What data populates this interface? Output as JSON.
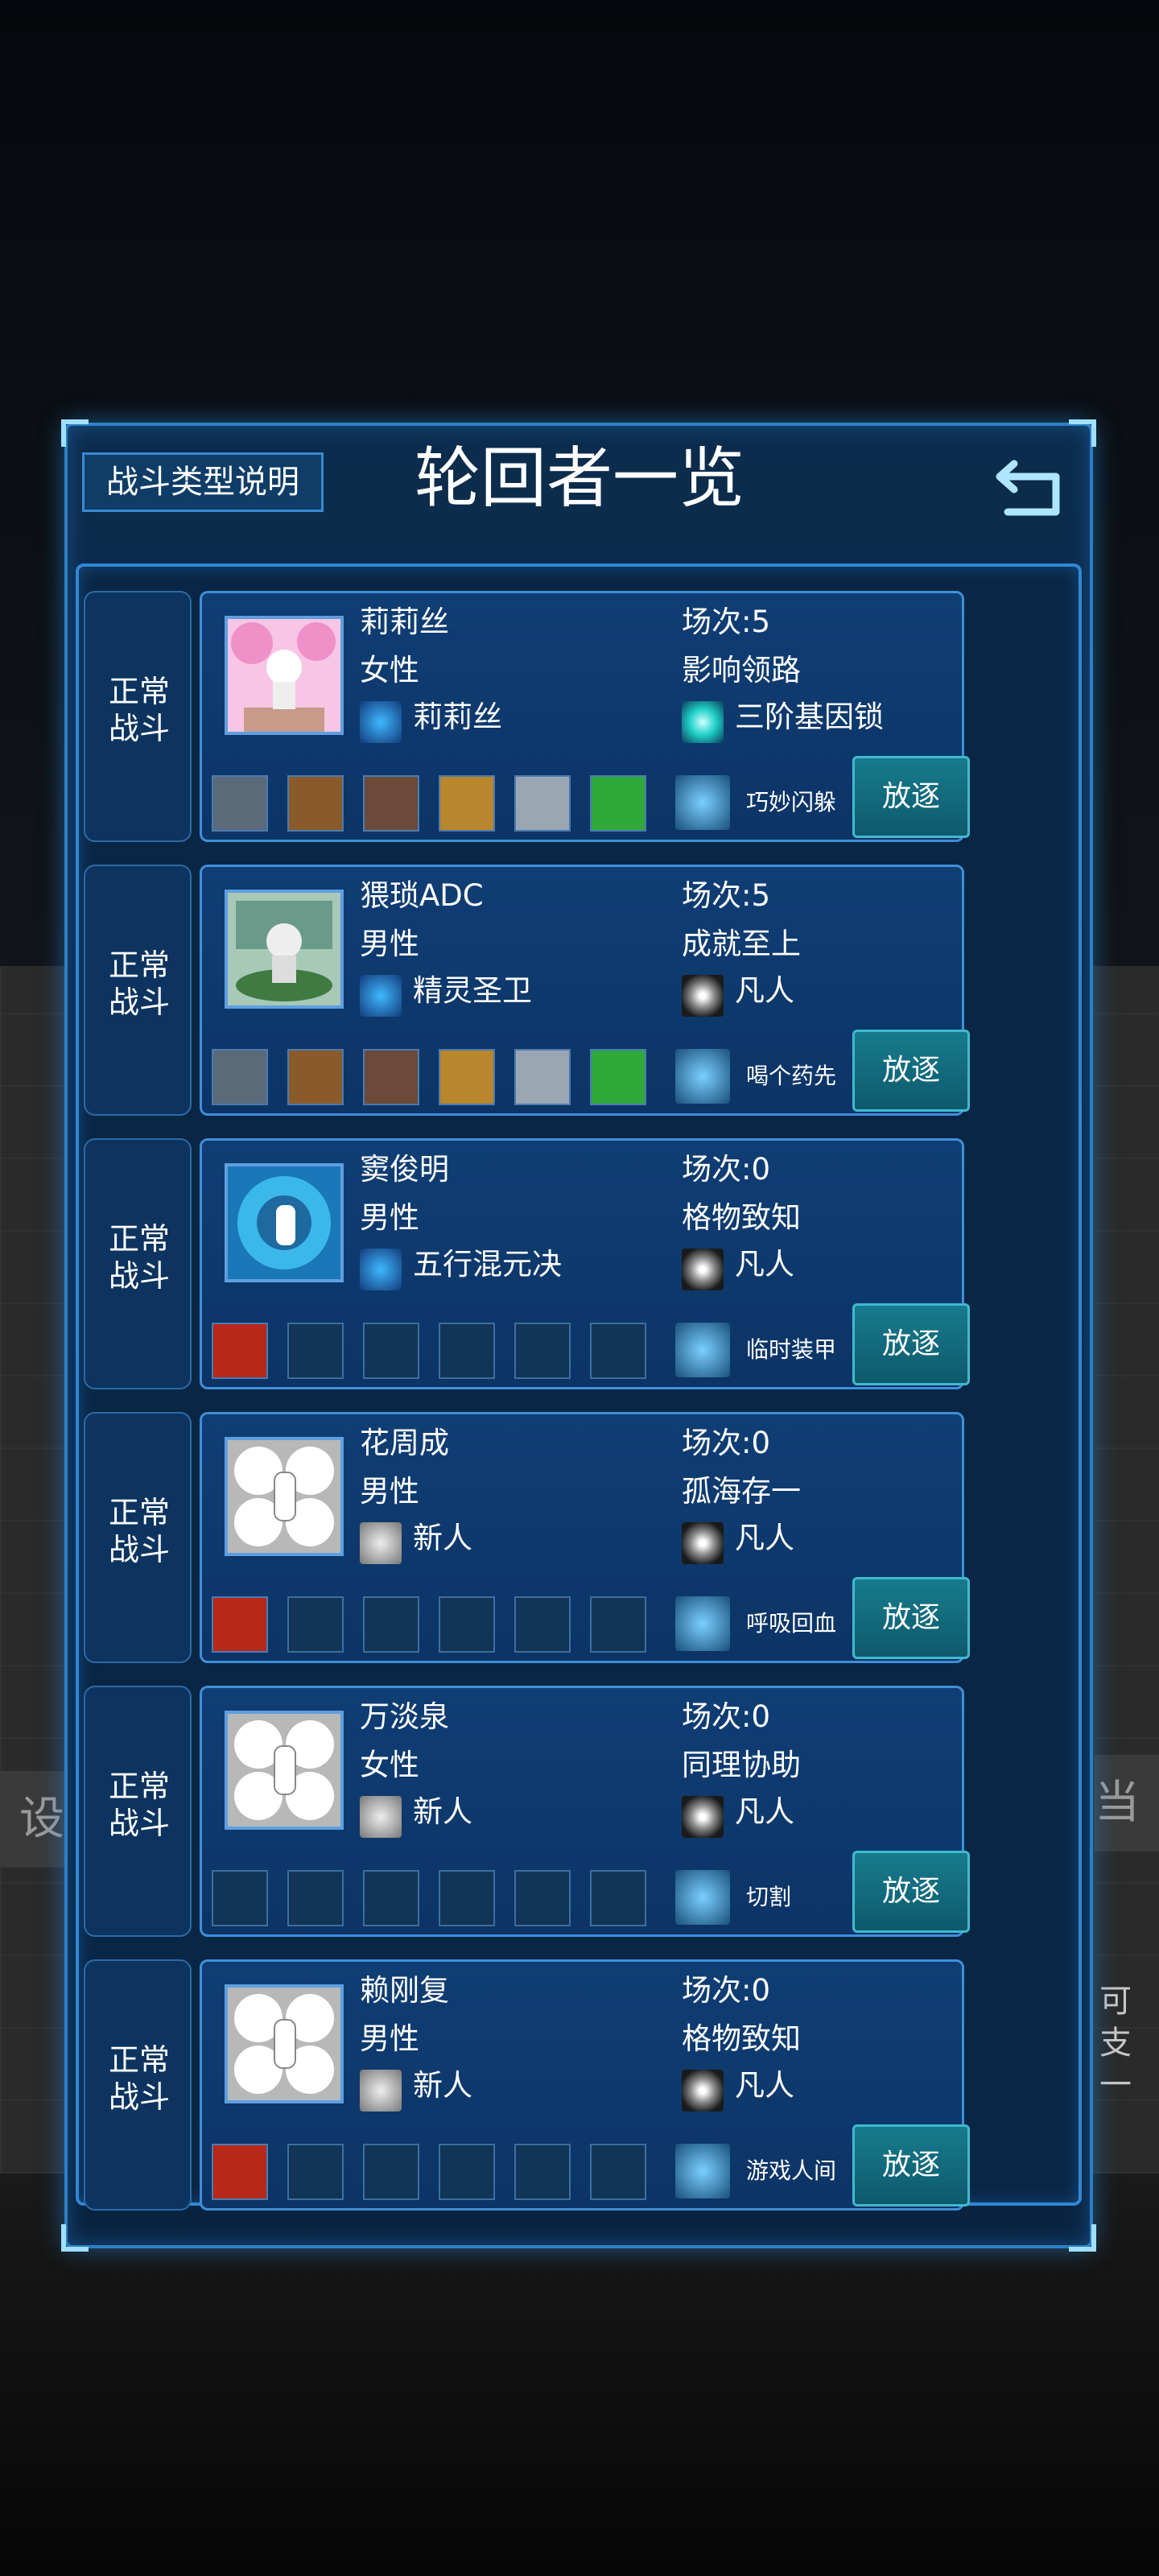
{
  "header": {
    "help_label": "战斗类型说明",
    "title": "轮回者一览",
    "back_icon": "return-arrow-icon"
  },
  "background": {
    "left_fragment": "设",
    "right_fragment": "当",
    "right_tip": [
      "可",
      "支",
      "一"
    ]
  },
  "exile_label": "放逐",
  "characters": [
    {
      "battle_type": [
        "正常",
        "战斗"
      ],
      "name": "莉莉丝",
      "gender": "女性",
      "bloodline": "莉莉丝",
      "matches": "场次:5",
      "trait": "影响领路",
      "gene_lock": "三阶基因锁",
      "skill": "巧妙闪躲",
      "avatar_color": "#f0b0d8",
      "items": 6
    },
    {
      "battle_type": [
        "正常",
        "战斗"
      ],
      "name": "猥琐ADC",
      "gender": "男性",
      "bloodline": "精灵圣卫",
      "matches": "场次:5",
      "trait": "成就至上",
      "gene_lock": "凡人",
      "skill": "喝个药先",
      "avatar_color": "#5a8f7a",
      "items": 6
    },
    {
      "battle_type": [
        "正常",
        "战斗"
      ],
      "name": "窦俊明",
      "gender": "男性",
      "bloodline": "五行混元决",
      "matches": "场次:0",
      "trait": "格物致知",
      "gene_lock": "凡人",
      "skill": "临时装甲",
      "avatar_color": "#2a9fd6",
      "items": 1
    },
    {
      "battle_type": [
        "正常",
        "战斗"
      ],
      "name": "花周成",
      "gender": "男性",
      "bloodline": "新人",
      "matches": "场次:0",
      "trait": "孤海存一",
      "gene_lock": "凡人",
      "skill": "呼吸回血",
      "avatar_color": "#cfcfcf",
      "items": 1
    },
    {
      "battle_type": [
        "正常",
        "战斗"
      ],
      "name": "万淡泉",
      "gender": "女性",
      "bloodline": "新人",
      "matches": "场次:0",
      "trait": "同理协助",
      "gene_lock": "凡人",
      "skill": "切割",
      "avatar_color": "#cfcfcf",
      "items": 0
    },
    {
      "battle_type": [
        "正常",
        "战斗"
      ],
      "name": "赖刚复",
      "gender": "男性",
      "bloodline": "新人",
      "matches": "场次:0",
      "trait": "格物致知",
      "gene_lock": "凡人",
      "skill": "游戏人间",
      "avatar_color": "#cfcfcf",
      "items": 1
    }
  ]
}
